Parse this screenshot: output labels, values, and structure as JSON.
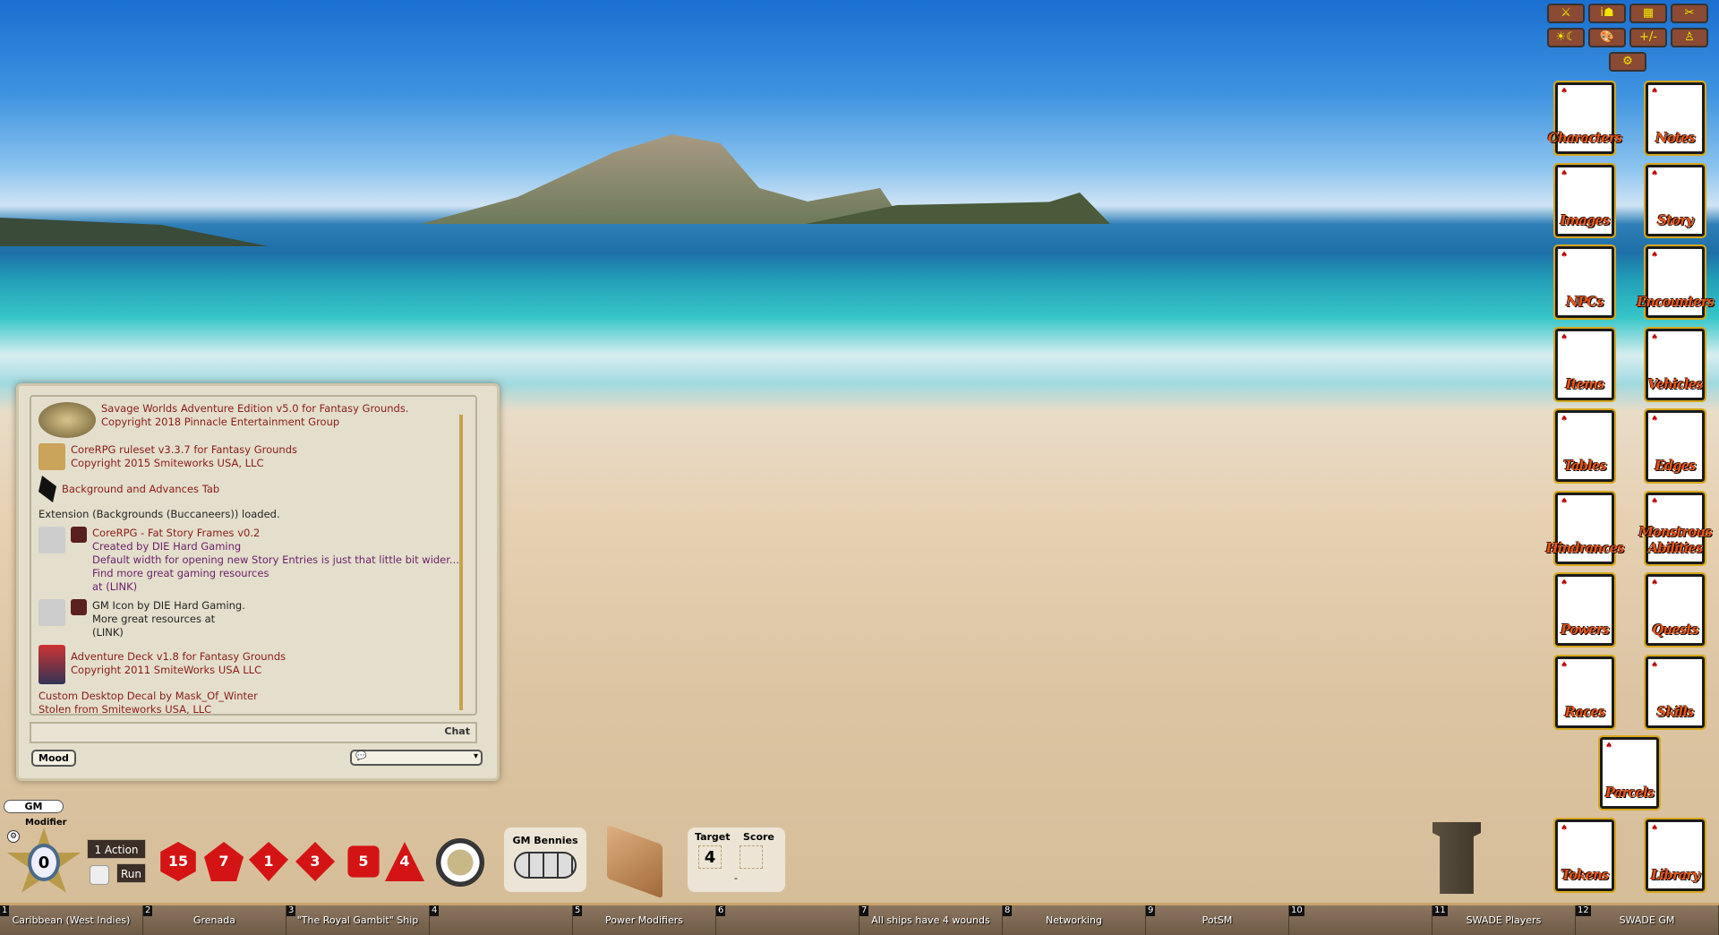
{
  "chat": {
    "messages": [
      {
        "text": "Savage Worlds Adventure Edition v5.0 for Fantasy Grounds. Copyright 2018 Pinnacle Entertainment Group",
        "icon": "savage-worlds-logo"
      },
      {
        "text": "CoreRPG ruleset v3.3.7 for Fantasy Grounds",
        "text2": "Copyright 2015 Smiteworks USA, LLC",
        "icon": "corerpg-icon"
      },
      {
        "text": "Background and Advances Tab",
        "icon": "extension-icon"
      },
      {
        "text": "Extension (Backgrounds (Buccaneers)) loaded."
      },
      {
        "lines": [
          "CoreRPG - Fat Story Frames v0.2",
          "Created by DIE Hard Gaming",
          "Default width for opening new Story Entries is just that little bit wider...",
          "Find more great gaming resources",
          "at (LINK)"
        ]
      },
      {
        "lines": [
          "GM Icon by DIE Hard Gaming.",
          "More great resources at",
          "(LINK)"
        ]
      },
      {
        "text": "Adventure Deck v1.8 for Fantasy Grounds",
        "text2": "Copyright 2011 SmiteWorks USA LLC"
      },
      {
        "text": "Custom Desktop Decal by Mask_Of_Winter",
        "text2": "Stolen from Smiteworks USA, LLC"
      }
    ],
    "chat_button": "Chat",
    "mood_button": "Mood",
    "input_value": ""
  },
  "top_buttons": [
    "combat-tracker",
    "party-sheet",
    "calendar",
    "options",
    "lighting",
    "colors",
    "modifiers",
    "effects",
    "settings"
  ],
  "top_button_glyphs": [
    "⚔",
    "i☗",
    "▦",
    "✂",
    "☀☾",
    "🎨",
    "+/-",
    "♙",
    "⚙"
  ],
  "sidebar": [
    "Characters",
    "Notes",
    "Images",
    "Story",
    "NPCs",
    "Encounters",
    "Items",
    "Vehicles",
    "Tables",
    "Edges",
    "Hindrances",
    "Monstrous Abilities",
    "Powers",
    "Quests",
    "Races",
    "Skills",
    "Parcels",
    "Tokens",
    "Library"
  ],
  "dice_area": {
    "gm_label": "GM",
    "modifier_label": "Modifier",
    "modifier_value": "0",
    "action_button": "1 Action",
    "run_button": "Run",
    "dice": [
      "d20",
      "d12",
      "d10",
      "d8",
      "d6",
      "d4"
    ],
    "dice_faces": [
      "15",
      "7",
      "1",
      "3",
      "5",
      "4"
    ],
    "bennies_label": "GM Bennies",
    "target_label": "Target",
    "target_value": "4",
    "score_label": "Score",
    "score_value": "-"
  },
  "hotbar": [
    {
      "n": "1",
      "label": "Caribbean (West Indies)"
    },
    {
      "n": "2",
      "label": "Grenada"
    },
    {
      "n": "3",
      "label": "\"The Royal Gambit\" Ship"
    },
    {
      "n": "4",
      "label": ""
    },
    {
      "n": "5",
      "label": "Power Modifiers"
    },
    {
      "n": "6",
      "label": ""
    },
    {
      "n": "7",
      "label": "All ships have 4 wounds"
    },
    {
      "n": "8",
      "label": "Networking"
    },
    {
      "n": "9",
      "label": "PotSM"
    },
    {
      "n": "10",
      "label": ""
    },
    {
      "n": "11",
      "label": "SWADE Players"
    },
    {
      "n": "12",
      "label": "SWADE GM"
    }
  ]
}
